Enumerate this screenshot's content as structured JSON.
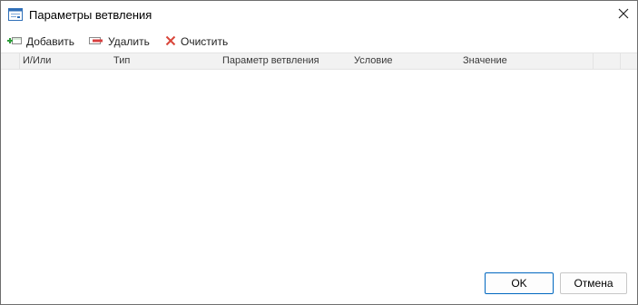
{
  "window": {
    "title": "Параметры ветвления"
  },
  "toolbar": {
    "add_label": "Добавить",
    "delete_label": "Удалить",
    "clear_label": "Очистить"
  },
  "grid": {
    "columns": [
      "И/Или",
      "Тип",
      "Параметр ветвления",
      "Условие",
      "Значение"
    ],
    "rows": []
  },
  "footer": {
    "ok_label": "OK",
    "cancel_label": "Отмена"
  },
  "colors": {
    "add_icon": "#2e9c3a",
    "delete_icon": "#d84040",
    "clear_icon": "#d9463a",
    "default_button_border": "#0067c0"
  },
  "icons": {
    "app": "dialog-window-icon",
    "close": "close-icon",
    "add": "add-row-icon",
    "delete": "delete-row-icon",
    "clear": "clear-x-icon"
  }
}
